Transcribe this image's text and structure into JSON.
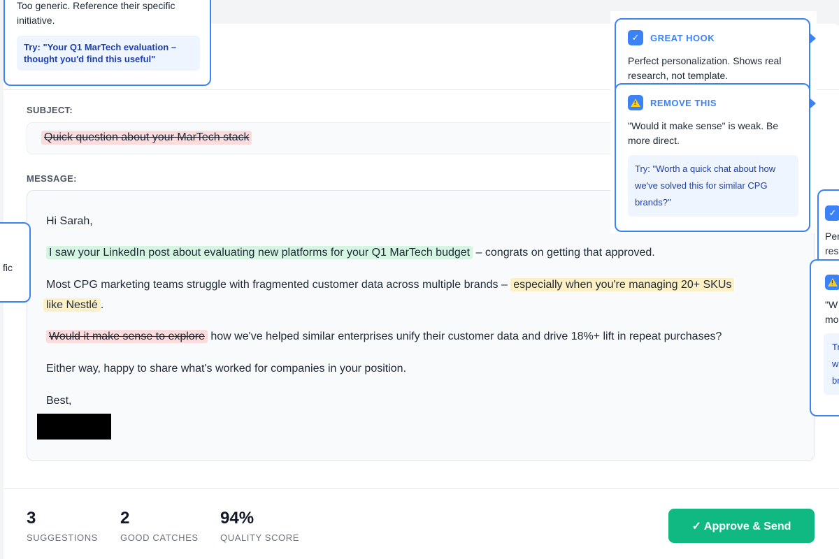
{
  "subject": {
    "label": "SUBJECT:",
    "value": "Quick question about your MarTech stack"
  },
  "message": {
    "label": "MESSAGE:",
    "greeting": "Hi Sarah,",
    "p1_highlight": "I saw your LinkedIn post about evaluating new platforms for your Q1 MarTech budget",
    "p1_rest": " – congrats on getting that approved.",
    "p2_start": "Most CPG marketing teams struggle with fragmented customer data across multiple brands – ",
    "p2_highlight_a": "especially when you're managing 20+ SKUs",
    "p2_highlight_b": "like Nestlé",
    "p2_end": ".",
    "p3_strike": "Would it make sense to explore",
    "p3_rest": " how we've helped similar enterprises unify their customer data and drive 18%+ lift in repeat purchases?",
    "p4": "Either way, happy to share what's worked for companies in your position.",
    "signoff": "Best,"
  },
  "callouts": {
    "top_left": {
      "body_line1": "Too generic. Reference their specific",
      "body_line2": "initiative.",
      "try_line1": "Try: \"Your Q1 MarTech evaluation –",
      "try_line2": "thought you'd find this useful\""
    },
    "great_hook": {
      "title": "GREAT HOOK",
      "body_line1": "Perfect personalization. Shows real",
      "body_line2": "research, not template."
    },
    "remove_this": {
      "title": "REMOVE THIS",
      "body_line1": "\"Would it make sense\" is weak. Be",
      "body_line2": "more direct.",
      "try_line1": "Try: \"Worth a quick chat about how",
      "try_line2": "we've solved this for similar CPG",
      "try_line3": "brands?\""
    },
    "left_partial": {
      "text": "fic"
    },
    "right_partial_1": {
      "line1": "Per",
      "line2": "res"
    },
    "right_partial_2": {
      "line1": "\"W",
      "line2": "mo",
      "try1": "Tr",
      "try2": "w",
      "try3": "br"
    }
  },
  "stats": [
    {
      "value": "3",
      "label": "SUGGESTIONS"
    },
    {
      "value": "2",
      "label": "GOOD CATCHES"
    },
    {
      "value": "94%",
      "label": "QUALITY SCORE"
    }
  ],
  "actions": {
    "approve_label": "✓ Approve & Send"
  },
  "colors": {
    "accent": "#3b82f6",
    "success": "#10b981",
    "good_highlight": "#d5f5e2",
    "warn_highlight": "#fdf0c4",
    "remove_highlight": "#fbdcdc"
  }
}
